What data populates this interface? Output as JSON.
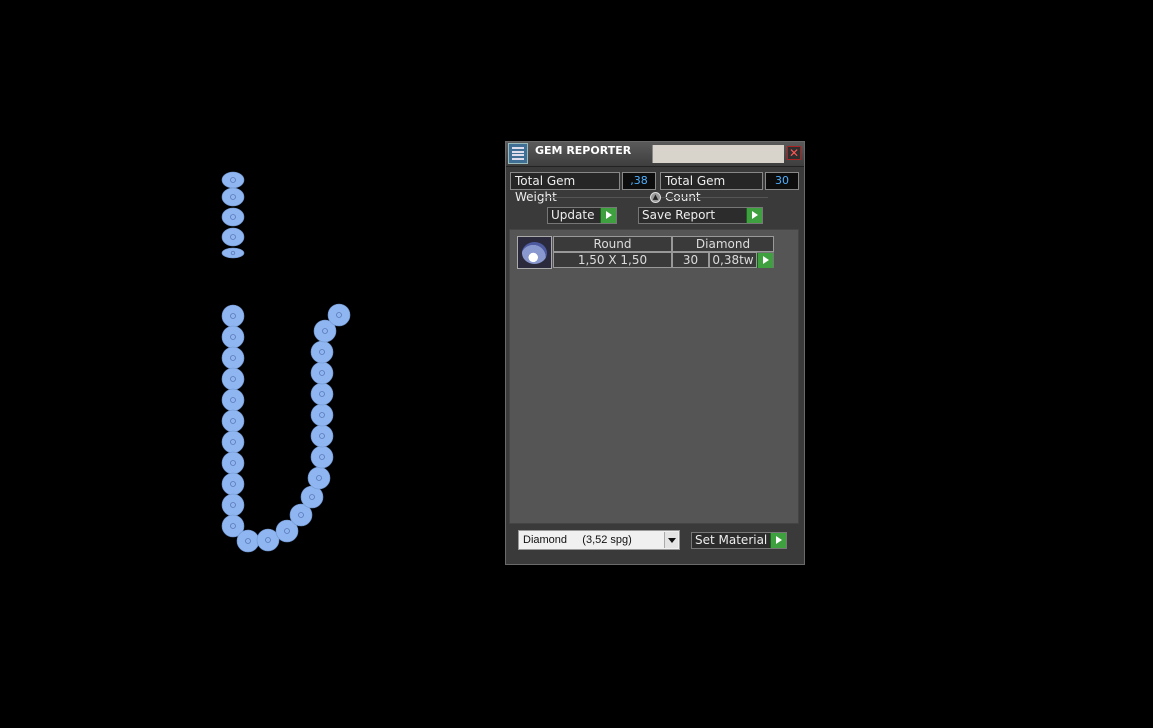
{
  "panel": {
    "title": "GEM REPORTER",
    "close_glyph": "✕",
    "total_weight_label": "Total Gem Weight",
    "total_weight_value": ",38",
    "total_count_label": "Total Gem Count",
    "total_count_value": "30",
    "update_label": "Update",
    "save_report_label": "Save Report",
    "gem_rows": [
      {
        "shape": "Round",
        "material": "Diamond",
        "size": "1,50 X 1,50",
        "count": "30",
        "weight": "0,38tw"
      }
    ],
    "material_select_value": "Diamond     (3,52 spg)",
    "set_material_label": "Set Material"
  },
  "icons": {
    "app": "gem-reporter-icon",
    "close": "close-icon",
    "collapse": "collapse-up-icon",
    "go": "play-arrow-icon",
    "thumbnail": "round-gem-thumbnail",
    "dropdown": "chevron-down-icon"
  },
  "colors": {
    "background": "#000000",
    "gem_fill": "#8fb6f0",
    "panel_bg": "#3a3a3a",
    "list_bg": "#555555",
    "value_text": "#4fb0ff",
    "go_button": "#3ea03e"
  },
  "viewport": {
    "gem_count_shown": 30,
    "gem_shape": "round",
    "gem_size": "1,50 X 1,50"
  }
}
